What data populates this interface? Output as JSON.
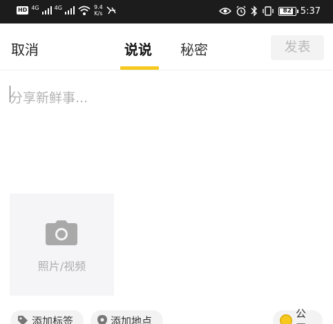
{
  "status_bar": {
    "hd": "HD",
    "net1": "4G",
    "net2": "4G",
    "speed_value": "9.4",
    "speed_unit": "K/s",
    "battery": "82",
    "time": "5:37",
    "icons": [
      "signal-icon",
      "wifi-icon",
      "eye-icon",
      "alarm-icon",
      "bluetooth-icon",
      "vibrate-icon",
      "battery-icon"
    ]
  },
  "header": {
    "cancel_label": "取消",
    "tabs": [
      {
        "label": "说说",
        "active": true
      },
      {
        "label": "秘密",
        "active": false
      }
    ],
    "publish_label": "发表"
  },
  "composer": {
    "placeholder": "分享新鲜事..."
  },
  "media": {
    "label": "照片/视频",
    "icon": "camera-icon"
  },
  "bottom": {
    "add_tag_label": "添加标签",
    "add_location_label": "添加地点",
    "visibility_label": "公开"
  },
  "colors": {
    "accent": "#f7c91f",
    "status_bar_bg": "#1c1c1c",
    "publish_disabled_bg": "#f3f3f3",
    "publish_disabled_text": "#b9b9b9"
  }
}
